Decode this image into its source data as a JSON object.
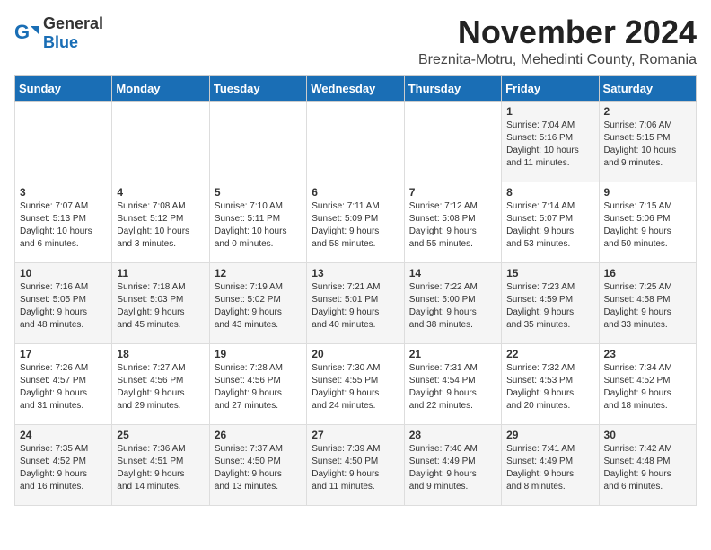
{
  "header": {
    "logo_general": "General",
    "logo_blue": "Blue",
    "month": "November 2024",
    "location": "Breznita-Motru, Mehedinti County, Romania"
  },
  "weekdays": [
    "Sunday",
    "Monday",
    "Tuesday",
    "Wednesday",
    "Thursday",
    "Friday",
    "Saturday"
  ],
  "weeks": [
    [
      {
        "day": "",
        "info": ""
      },
      {
        "day": "",
        "info": ""
      },
      {
        "day": "",
        "info": ""
      },
      {
        "day": "",
        "info": ""
      },
      {
        "day": "",
        "info": ""
      },
      {
        "day": "1",
        "info": "Sunrise: 7:04 AM\nSunset: 5:16 PM\nDaylight: 10 hours\nand 11 minutes."
      },
      {
        "day": "2",
        "info": "Sunrise: 7:06 AM\nSunset: 5:15 PM\nDaylight: 10 hours\nand 9 minutes."
      }
    ],
    [
      {
        "day": "3",
        "info": "Sunrise: 7:07 AM\nSunset: 5:13 PM\nDaylight: 10 hours\nand 6 minutes."
      },
      {
        "day": "4",
        "info": "Sunrise: 7:08 AM\nSunset: 5:12 PM\nDaylight: 10 hours\nand 3 minutes."
      },
      {
        "day": "5",
        "info": "Sunrise: 7:10 AM\nSunset: 5:11 PM\nDaylight: 10 hours\nand 0 minutes."
      },
      {
        "day": "6",
        "info": "Sunrise: 7:11 AM\nSunset: 5:09 PM\nDaylight: 9 hours\nand 58 minutes."
      },
      {
        "day": "7",
        "info": "Sunrise: 7:12 AM\nSunset: 5:08 PM\nDaylight: 9 hours\nand 55 minutes."
      },
      {
        "day": "8",
        "info": "Sunrise: 7:14 AM\nSunset: 5:07 PM\nDaylight: 9 hours\nand 53 minutes."
      },
      {
        "day": "9",
        "info": "Sunrise: 7:15 AM\nSunset: 5:06 PM\nDaylight: 9 hours\nand 50 minutes."
      }
    ],
    [
      {
        "day": "10",
        "info": "Sunrise: 7:16 AM\nSunset: 5:05 PM\nDaylight: 9 hours\nand 48 minutes."
      },
      {
        "day": "11",
        "info": "Sunrise: 7:18 AM\nSunset: 5:03 PM\nDaylight: 9 hours\nand 45 minutes."
      },
      {
        "day": "12",
        "info": "Sunrise: 7:19 AM\nSunset: 5:02 PM\nDaylight: 9 hours\nand 43 minutes."
      },
      {
        "day": "13",
        "info": "Sunrise: 7:21 AM\nSunset: 5:01 PM\nDaylight: 9 hours\nand 40 minutes."
      },
      {
        "day": "14",
        "info": "Sunrise: 7:22 AM\nSunset: 5:00 PM\nDaylight: 9 hours\nand 38 minutes."
      },
      {
        "day": "15",
        "info": "Sunrise: 7:23 AM\nSunset: 4:59 PM\nDaylight: 9 hours\nand 35 minutes."
      },
      {
        "day": "16",
        "info": "Sunrise: 7:25 AM\nSunset: 4:58 PM\nDaylight: 9 hours\nand 33 minutes."
      }
    ],
    [
      {
        "day": "17",
        "info": "Sunrise: 7:26 AM\nSunset: 4:57 PM\nDaylight: 9 hours\nand 31 minutes."
      },
      {
        "day": "18",
        "info": "Sunrise: 7:27 AM\nSunset: 4:56 PM\nDaylight: 9 hours\nand 29 minutes."
      },
      {
        "day": "19",
        "info": "Sunrise: 7:28 AM\nSunset: 4:56 PM\nDaylight: 9 hours\nand 27 minutes."
      },
      {
        "day": "20",
        "info": "Sunrise: 7:30 AM\nSunset: 4:55 PM\nDaylight: 9 hours\nand 24 minutes."
      },
      {
        "day": "21",
        "info": "Sunrise: 7:31 AM\nSunset: 4:54 PM\nDaylight: 9 hours\nand 22 minutes."
      },
      {
        "day": "22",
        "info": "Sunrise: 7:32 AM\nSunset: 4:53 PM\nDaylight: 9 hours\nand 20 minutes."
      },
      {
        "day": "23",
        "info": "Sunrise: 7:34 AM\nSunset: 4:52 PM\nDaylight: 9 hours\nand 18 minutes."
      }
    ],
    [
      {
        "day": "24",
        "info": "Sunrise: 7:35 AM\nSunset: 4:52 PM\nDaylight: 9 hours\nand 16 minutes."
      },
      {
        "day": "25",
        "info": "Sunrise: 7:36 AM\nSunset: 4:51 PM\nDaylight: 9 hours\nand 14 minutes."
      },
      {
        "day": "26",
        "info": "Sunrise: 7:37 AM\nSunset: 4:50 PM\nDaylight: 9 hours\nand 13 minutes."
      },
      {
        "day": "27",
        "info": "Sunrise: 7:39 AM\nSunset: 4:50 PM\nDaylight: 9 hours\nand 11 minutes."
      },
      {
        "day": "28",
        "info": "Sunrise: 7:40 AM\nSunset: 4:49 PM\nDaylight: 9 hours\nand 9 minutes."
      },
      {
        "day": "29",
        "info": "Sunrise: 7:41 AM\nSunset: 4:49 PM\nDaylight: 9 hours\nand 8 minutes."
      },
      {
        "day": "30",
        "info": "Sunrise: 7:42 AM\nSunset: 4:48 PM\nDaylight: 9 hours\nand 6 minutes."
      }
    ]
  ]
}
